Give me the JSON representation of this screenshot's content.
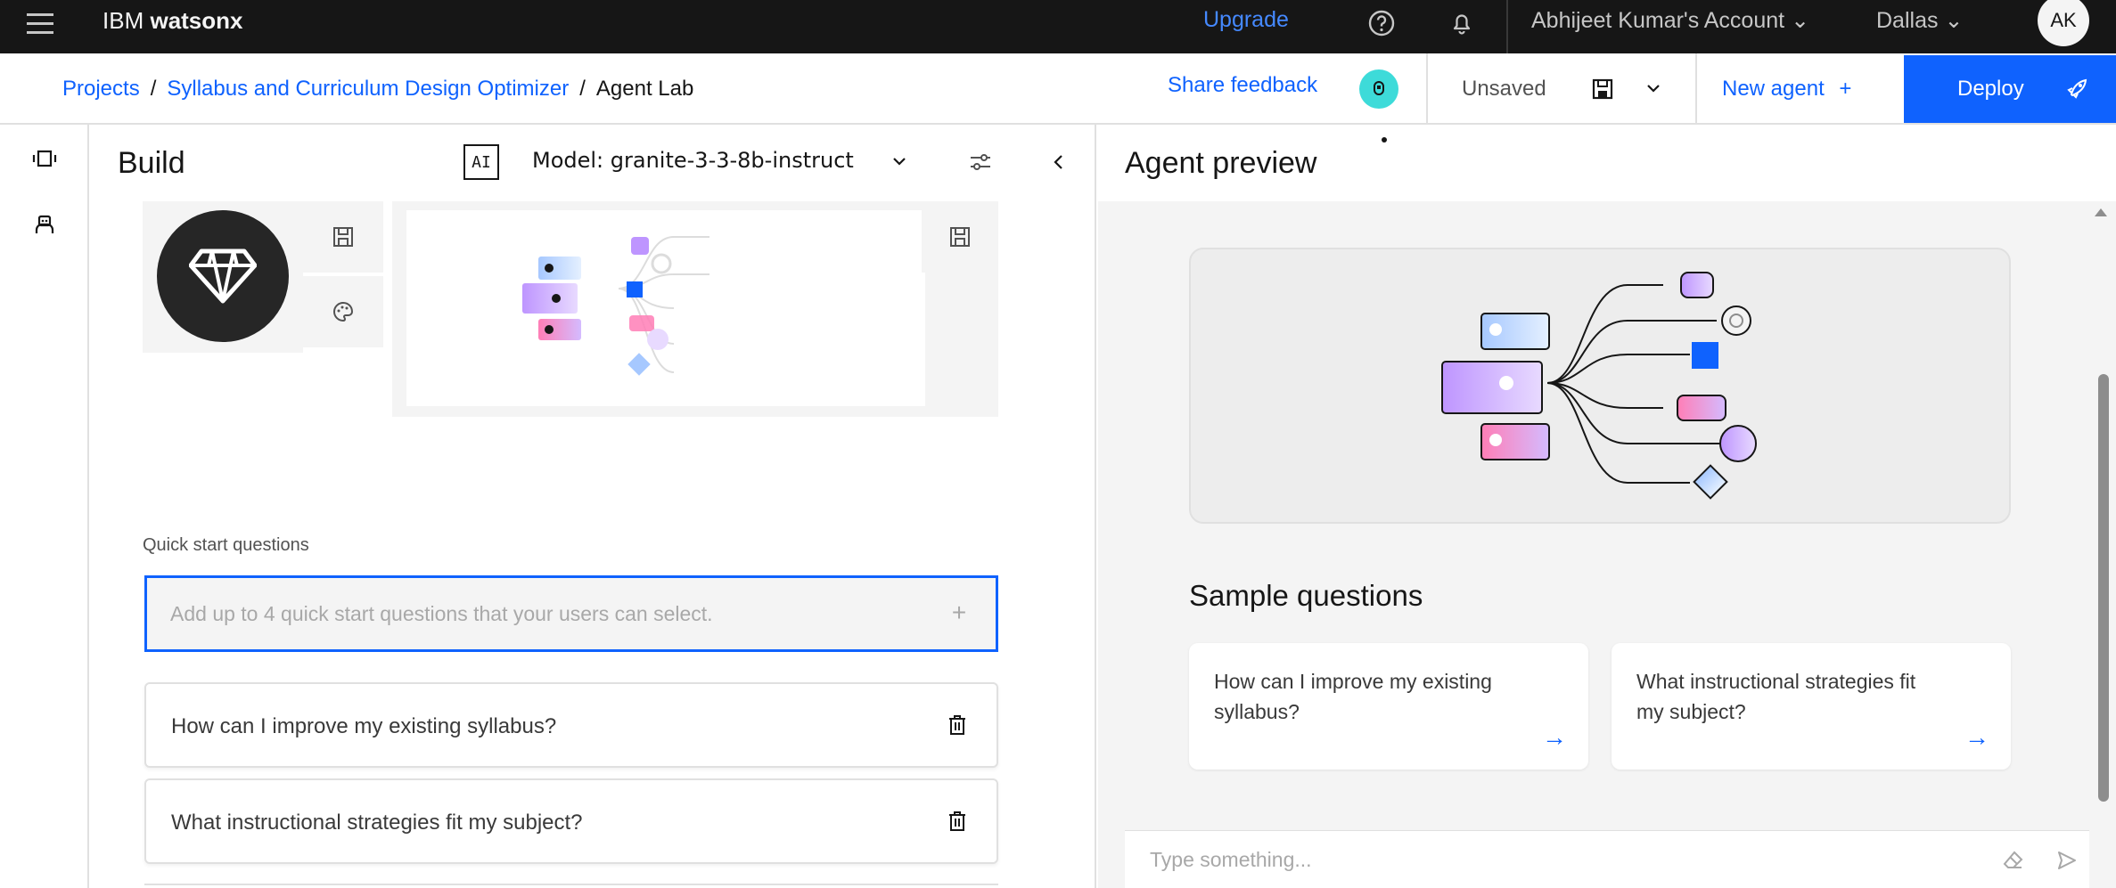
{
  "header": {
    "brand_prefix": "IBM",
    "brand_product": "watsonx",
    "upgrade_label": "Upgrade",
    "account_label": "Abhijeet Kumar's Account",
    "region_label": "Dallas",
    "avatar_initials": "AK"
  },
  "breadcrumb": {
    "items": [
      "Projects",
      "Syllabus and Curriculum Design Optimizer",
      "Agent Lab"
    ],
    "separator": "/"
  },
  "toolbar": {
    "share_feedback_label": "Share feedback",
    "status_label": "Unsaved",
    "new_agent_label": "New agent",
    "deploy_label": "Deploy"
  },
  "build": {
    "title": "Build",
    "ai_badge": "AI",
    "model_label": "Model: granite-3-3-8b-instruct",
    "quick_start_label": "Quick start questions",
    "quick_start_placeholder": "Add up to 4 quick start questions that your users can select.",
    "questions": [
      "How can I improve my existing syllabus?",
      "What instructional strategies fit my subject?"
    ]
  },
  "preview": {
    "title": "Agent preview",
    "sample_title": "Sample questions",
    "sample_questions": [
      "How can I improve my existing syllabus?",
      "What instructional strategies fit my subject?"
    ],
    "chat_placeholder": "Type something..."
  },
  "colors": {
    "topbar_bg": "#161616",
    "accent_blue": "#0f62fe",
    "link_blue": "#4589ff",
    "feedback_badge": "#3ddbd9",
    "panel_bg": "#f4f4f4"
  },
  "icons": {
    "menu": "hamburger-menu-icon",
    "help": "help-icon",
    "notifications": "bell-icon",
    "save": "save-icon",
    "deploy": "rocket-icon",
    "agent_avatar": "diamond-icon",
    "delete": "trash-icon",
    "send": "send-icon"
  }
}
